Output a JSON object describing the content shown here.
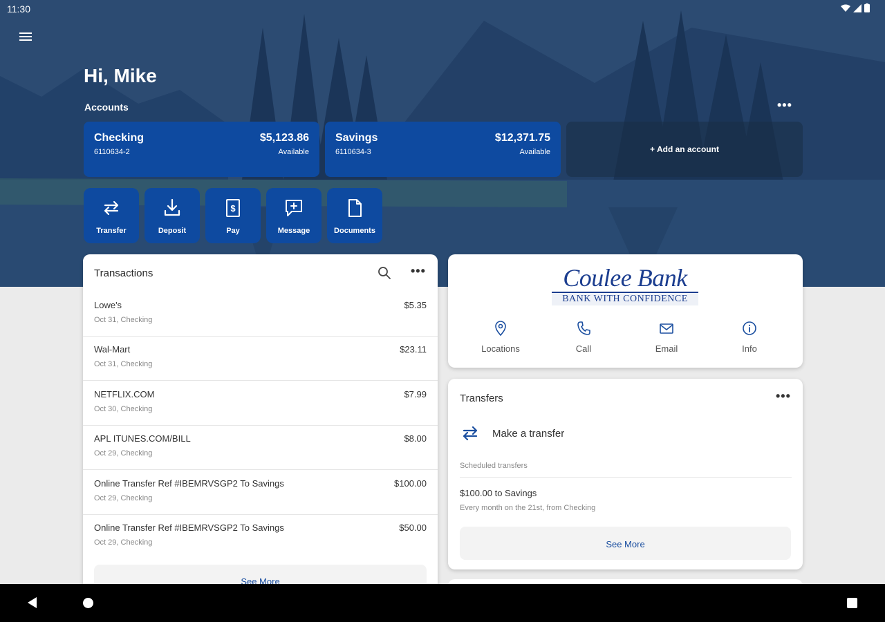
{
  "status_bar": {
    "time": "11:30",
    "icons": [
      "wifi-icon",
      "signal-icon",
      "battery-icon"
    ]
  },
  "header": {
    "greeting": "Hi, Mike",
    "accounts_label": "Accounts",
    "accounts_more": "•••"
  },
  "accounts": [
    {
      "name": "Checking",
      "number": "6110634-2",
      "balance": "$5,123.86",
      "balance_label": "Available"
    },
    {
      "name": "Savings",
      "number": "6110634-3",
      "balance": "$12,371.75",
      "balance_label": "Available"
    }
  ],
  "add_account_label": "+ Add an account",
  "actions": [
    {
      "label": "Transfer",
      "icon": "transfer-icon"
    },
    {
      "label": "Deposit",
      "icon": "deposit-icon"
    },
    {
      "label": "Pay",
      "icon": "pay-icon"
    },
    {
      "label": "Message",
      "icon": "message-icon"
    },
    {
      "label": "Documents",
      "icon": "documents-icon"
    }
  ],
  "transactions": {
    "title": "Transactions",
    "more": "•••",
    "items": [
      {
        "description": "Lowe's",
        "detail": "Oct 31, Checking",
        "amount": "$5.35"
      },
      {
        "description": "Wal-Mart",
        "detail": "Oct 31, Checking",
        "amount": "$23.11"
      },
      {
        "description": "NETFLIX.COM",
        "detail": "Oct 30, Checking",
        "amount": "$7.99"
      },
      {
        "description": "APL ITUNES.COM/BILL",
        "detail": "Oct 29, Checking",
        "amount": "$8.00"
      },
      {
        "description": "Online Transfer Ref #IBEMRVSGP2 To Savings",
        "detail": "Oct 29, Checking",
        "amount": "$100.00"
      },
      {
        "description": "Online Transfer Ref #IBEMRVSGP2 To Savings",
        "detail": "Oct 29, Checking",
        "amount": "$50.00"
      }
    ],
    "see_more": "See More"
  },
  "bank": {
    "name": "Coulee Bank",
    "tagline": "BANK WITH CONFIDENCE",
    "actions": [
      {
        "label": "Locations",
        "icon": "location-pin-icon"
      },
      {
        "label": "Call",
        "icon": "phone-icon"
      },
      {
        "label": "Email",
        "icon": "email-icon"
      },
      {
        "label": "Info",
        "icon": "info-icon"
      }
    ]
  },
  "transfers": {
    "title": "Transfers",
    "more": "•••",
    "make_transfer": "Make a transfer",
    "scheduled_label": "Scheduled transfers",
    "scheduled": [
      {
        "amount": "$100.00 to Savings",
        "detail": "Every month on the 21st, from Checking"
      }
    ],
    "see_more": "See More"
  },
  "colors": {
    "brand_blue": "#0e4aa0",
    "link_blue": "#1b4fa0",
    "hero_bg": "#27466c"
  }
}
